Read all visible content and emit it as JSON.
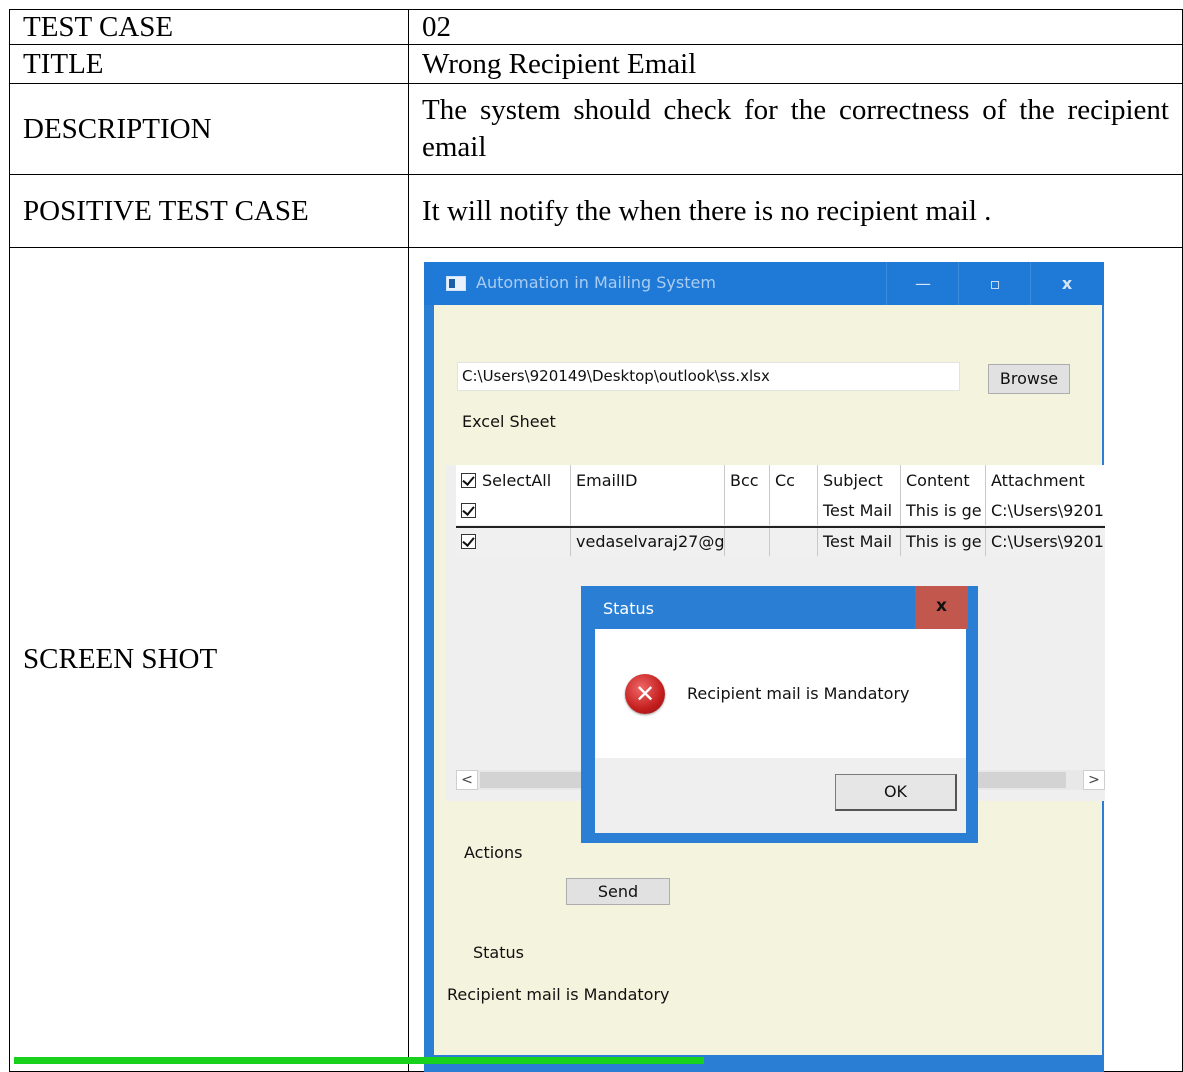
{
  "doc": {
    "rows": [
      {
        "label": "TEST CASE",
        "value": "02"
      },
      {
        "label": "TITLE",
        "value": "Wrong Recipient Email"
      },
      {
        "label": "DESCRIPTION",
        "value": "The system should check for the correctness of the recipient email"
      },
      {
        "label": "POSITIVE TEST CASE",
        "value": "It will notify the when there is no recipient mail ."
      },
      {
        "label": "SCREEN SHOT"
      }
    ]
  },
  "app": {
    "title": "Automation in Mailing System",
    "window_controls": {
      "minimize": "—",
      "maximize": "▫",
      "close": "x"
    },
    "file_path": "C:\\Users\\920149\\Desktop\\outlook\\ss.xlsx",
    "browse_label": "Browse",
    "excel_label": "Excel Sheet",
    "grid": {
      "columns": [
        "SelectAll",
        "EmailID",
        "Bcc",
        "Cc",
        "Subject",
        "Content",
        "Attachment"
      ],
      "rows": [
        {
          "selected": true,
          "email": "",
          "bcc": "",
          "cc": "",
          "subject": "Test Mail",
          "content": "This is ge",
          "attachment": "C:\\Users\\9201"
        },
        {
          "selected": true,
          "email": "vedaselvaraj27@g",
          "bcc": "",
          "cc": "",
          "subject": "Test Mail",
          "content": "This is ge",
          "attachment": "C:\\Users\\9201"
        }
      ]
    },
    "scroll_left": "<",
    "scroll_right": ">",
    "actions_label": "Actions",
    "send_label": "Send",
    "status_label": "Status",
    "status_text": "Recipient mail is Mandatory"
  },
  "dialog": {
    "title": "Status",
    "close": "x",
    "icon": "error-icon",
    "message": "Recipient mail is Mandatory",
    "ok_label": "OK"
  },
  "colors": {
    "titlebar": "#1f79d6",
    "client_bg": "#f4f3dd",
    "dialog_close": "#c2574d",
    "progress": "#17d11c"
  }
}
